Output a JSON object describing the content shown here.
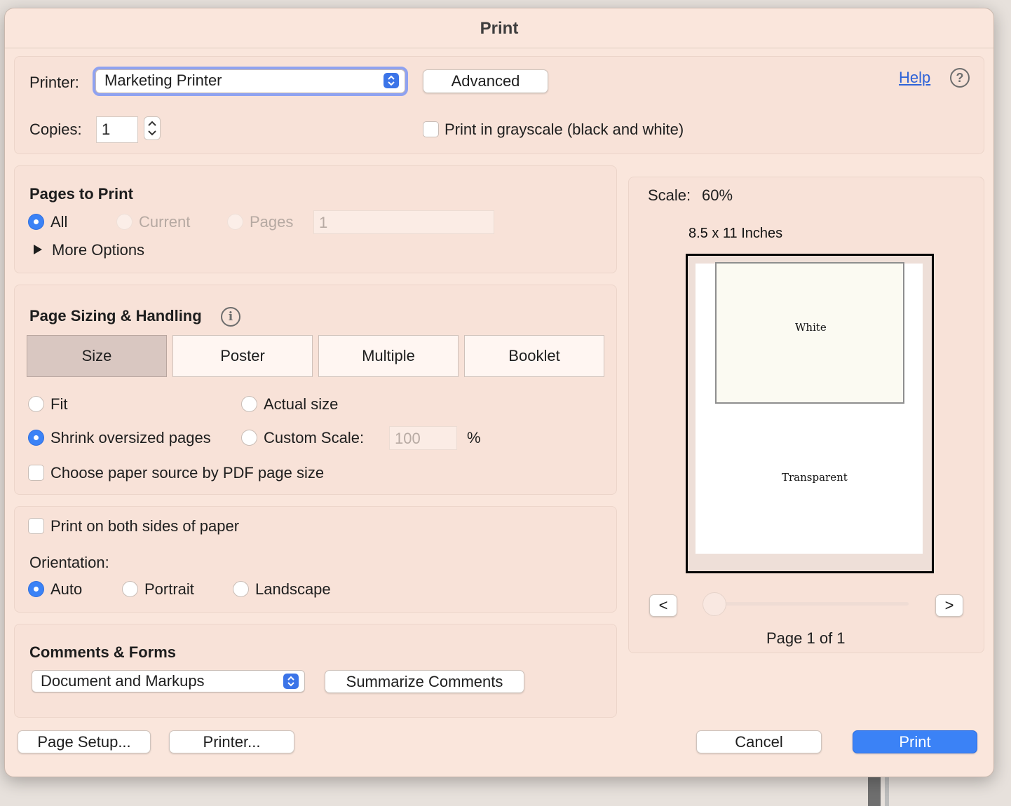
{
  "dialog": {
    "title": "Print"
  },
  "printer": {
    "label": "Printer:",
    "selected": "Marketing Printer",
    "advanced_label": "Advanced",
    "help_label": "Help",
    "help_icon": "?"
  },
  "copies": {
    "label": "Copies:",
    "value": "1",
    "grayscale_label": "Print in grayscale (black and white)",
    "grayscale_checked": false
  },
  "pages_to_print": {
    "title": "Pages to Print",
    "all_label": "All",
    "current_label": "Current",
    "pages_label": "Pages",
    "pages_value": "1",
    "selected": "All",
    "more_options_label": "More Options"
  },
  "page_sizing": {
    "title": "Page Sizing & Handling",
    "info_icon": "i",
    "tabs": [
      "Size",
      "Poster",
      "Multiple",
      "Booklet"
    ],
    "selected_tab": "Size",
    "fit_label": "Fit",
    "actual_size_label": "Actual size",
    "shrink_label": "Shrink oversized pages",
    "custom_scale_label": "Custom Scale:",
    "custom_scale_value": "100",
    "percent_label": "%",
    "selected_option": "Shrink oversized pages",
    "paper_source_label": "Choose paper source by PDF page size"
  },
  "orientation": {
    "both_sides_label": "Print on both sides of paper",
    "title": "Orientation:",
    "auto_label": "Auto",
    "portrait_label": "Portrait",
    "landscape_label": "Landscape",
    "selected": "Auto"
  },
  "comments_forms": {
    "title": "Comments & Forms",
    "selected": "Document and Markups",
    "summarize_label": "Summarize Comments"
  },
  "preview": {
    "scale_label": "Scale:",
    "scale_value": "60%",
    "paper_size": "8.5 x 11 Inches",
    "white_box_text": "White",
    "transparent_text": "Transparent",
    "prev_label": "<",
    "next_label": ">",
    "page_indicator": "Page 1 of 1",
    "page_position": 1,
    "page_count": 1
  },
  "footer": {
    "page_setup_label": "Page Setup...",
    "printer_label": "Printer...",
    "cancel_label": "Cancel",
    "print_label": "Print"
  },
  "colors": {
    "accent": "#3b82f6",
    "dialog_bg": "#fae6dc",
    "panel_bg": "#f8e2d8"
  }
}
